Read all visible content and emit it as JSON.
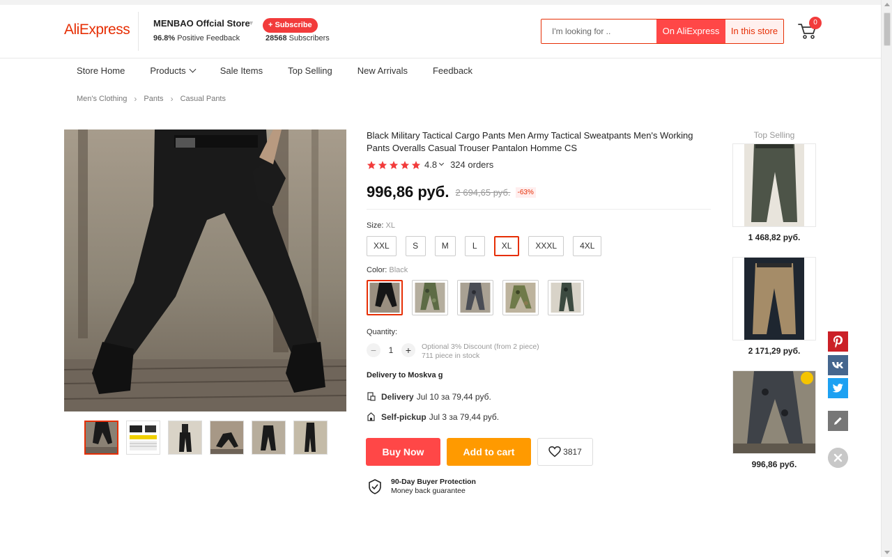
{
  "header": {
    "logo": "AliExpress",
    "store_name": "MENBAO Offcial Store",
    "feedback_percent": "96.8%",
    "feedback_label": "Positive Feedback",
    "subscribe_label": "+ Subscribe",
    "subscribers_count": "28568",
    "subscribers_label": "Subscribers",
    "search_placeholder": "I'm looking for ..",
    "search_on_aliexpress": "On AliExpress",
    "search_in_store": "In this store",
    "cart_count": "0"
  },
  "nav": {
    "items": [
      "Store Home",
      "Products",
      "Sale Items",
      "Top Selling",
      "New Arrivals",
      "Feedback"
    ]
  },
  "breadcrumb": [
    "Men's Clothing",
    "Pants",
    "Casual Pants"
  ],
  "product": {
    "title": "Black Military Tactical Cargo Pants Men Army Tactical Sweatpants Men's Working Pants Overalls Casual Trouser Pantalon Homme CS",
    "rating": "4.8",
    "stars": 5,
    "orders": "324 orders",
    "price": "996,86 руб.",
    "old_price": "2 694,65 руб.",
    "discount": "-63%",
    "size_label": "Size:",
    "size_selected": "XL",
    "sizes": [
      "XXL",
      "S",
      "M",
      "L",
      "XL",
      "XXXL",
      "4XL"
    ],
    "color_label": "Color:",
    "color_selected": "Black",
    "quantity_label": "Quantity:",
    "quantity_minus": "−",
    "quantity_value": "1",
    "quantity_plus": "+",
    "discount_note": "Optional 3% Discount (from 2 piece)",
    "stock_note": "711 piece in stock",
    "delivery_to": "Delivery to Moskva g",
    "delivery_label": "Delivery",
    "delivery_detail": "Jul 10 за 79,44 руб.",
    "pickup_label": "Self-pickup",
    "pickup_detail": "Jul 3 за 79,44 руб.",
    "buy_now": "Buy Now",
    "add_to_cart": "Add to cart",
    "wishlist_count": "3817",
    "protection_title": "90-Day Buyer Protection",
    "protection_subtitle": "Money back guarantee"
  },
  "top_selling": {
    "title": "Top Selling",
    "items": [
      {
        "price": "1 468,82 руб."
      },
      {
        "price": "2 171,29 руб."
      },
      {
        "price": "996,86 руб."
      }
    ]
  },
  "share": [
    "pinterest-icon",
    "vk-icon",
    "twitter-icon",
    "edit-icon"
  ],
  "colors": {
    "brand": "#e62e04",
    "buy_now": "#ff4747",
    "add_to_cart": "#ff9a00"
  }
}
